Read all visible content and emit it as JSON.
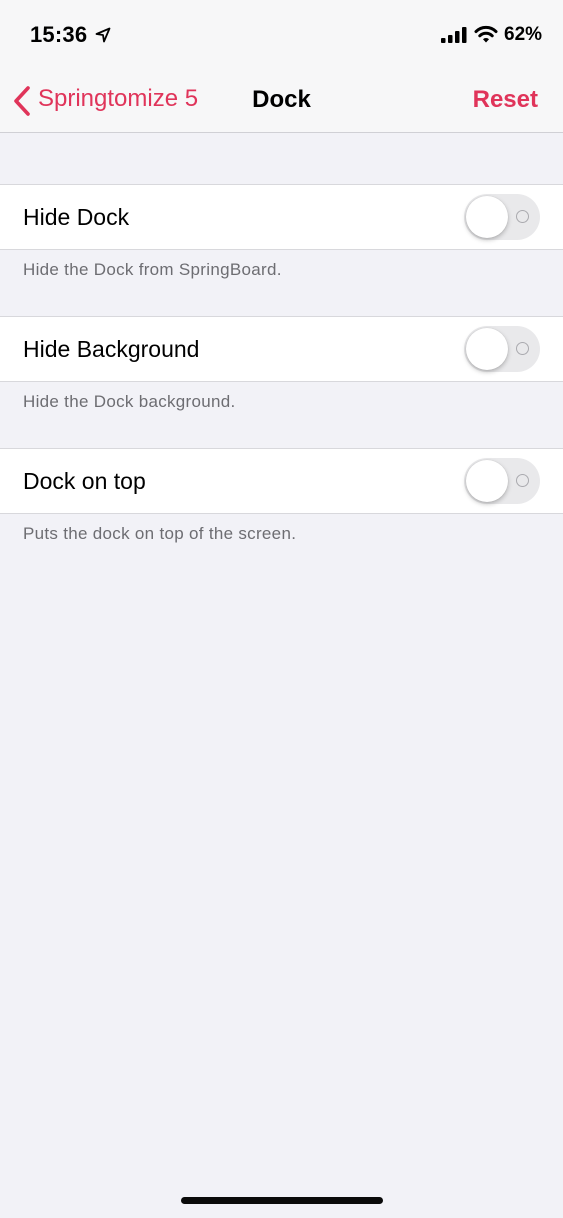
{
  "status_bar": {
    "time": "15:36",
    "battery": "62%",
    "icons": [
      "location-arrow-icon",
      "cellular-signal-icon",
      "wifi-icon"
    ]
  },
  "nav": {
    "back_label": "Springtomize 5",
    "title": "Dock",
    "reset_label": "Reset"
  },
  "settings": [
    {
      "label": "Hide Dock",
      "footer": "Hide the Dock from SpringBoard.",
      "enabled": false
    },
    {
      "label": "Hide Background",
      "footer": "Hide the Dock background.",
      "enabled": false
    },
    {
      "label": "Dock on top",
      "footer": "Puts the dock on top of the screen.",
      "enabled": false
    }
  ],
  "colors": {
    "accent": "#e0345a",
    "background": "#f2f2f7",
    "footer_text": "#6d6d72",
    "toggle_off": "#e9e9eb"
  }
}
